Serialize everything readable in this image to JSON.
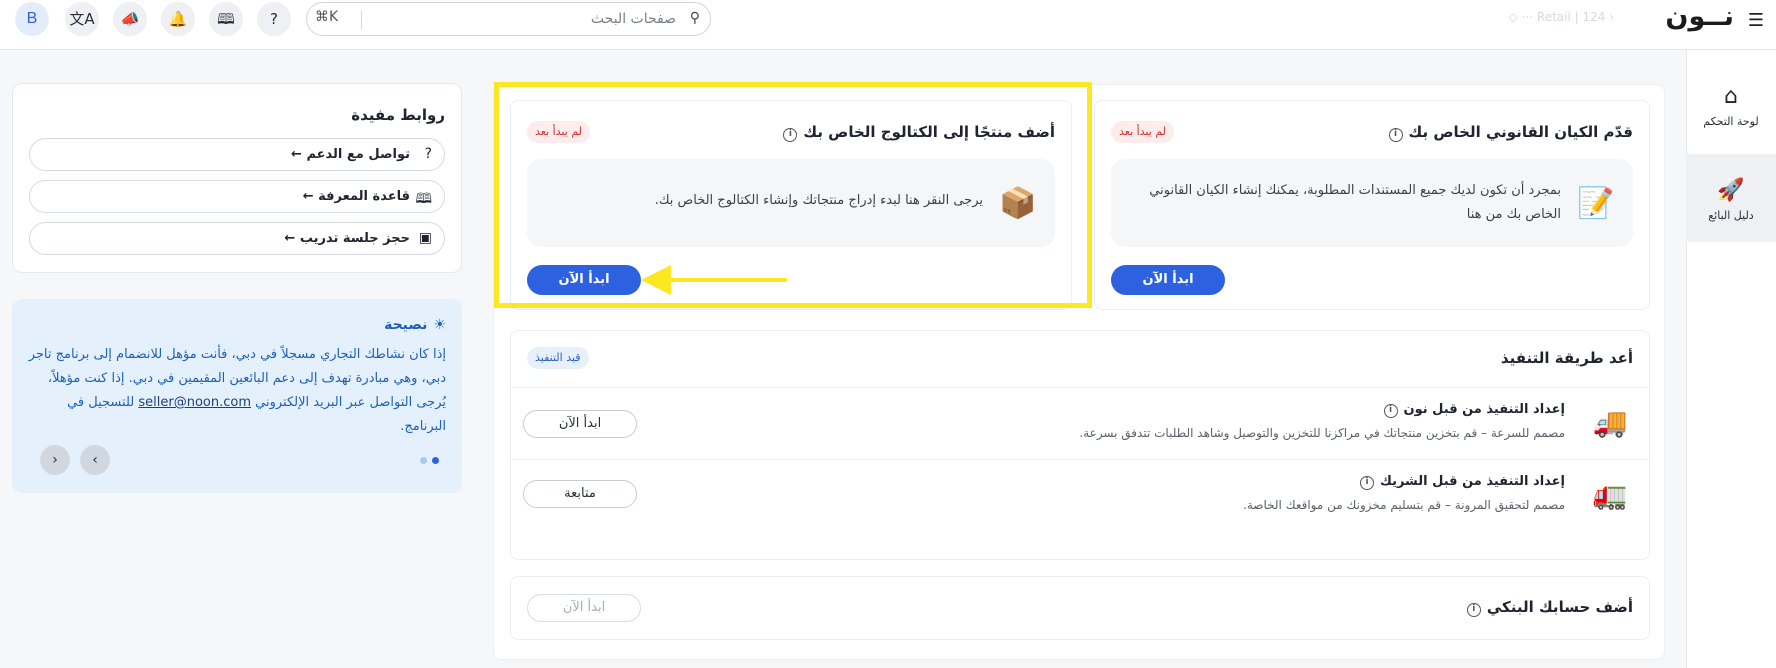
{
  "header": {
    "menu_icon": "hamburger-icon",
    "logo_text": "نــون",
    "store_selector": "Retail | 124",
    "search_placeholder": "صفحات البحث",
    "search_shortcut": "⌘K",
    "avatar_letter": "B",
    "icons": [
      "translate-icon",
      "megaphone-icon",
      "bell-icon",
      "book-icon",
      "help-icon"
    ]
  },
  "sidenav": {
    "items": [
      {
        "label": "لوحة التحكم",
        "icon": "home-icon",
        "active": false
      },
      {
        "label": "دليل البائع",
        "icon": "rocket-icon",
        "active": true
      }
    ]
  },
  "cards": {
    "legal_entity": {
      "title": "قدّم الكيان القانوني الخاص بك",
      "status": "لم يبدأ بعد",
      "description": "بمجرد أن تكون لديك جميع المستندات المطلوبة، يمكنك إنشاء الكيان القانوني الخاص بك من هنا",
      "button": "ابدأ الآن"
    },
    "add_product": {
      "title": "أضف منتجًا إلى الكتالوج الخاص بك",
      "status": "لم يبدأ بعد",
      "description": "يرجى النقر هنا لبدء إدراج منتجاتك وإنشاء الكتالوج الخاص بك.",
      "button": "ابدأ الآن"
    },
    "fulfillment": {
      "title": "أعد طريقة التنفيذ",
      "status": "قيد التنفيذ",
      "options": [
        {
          "title": "إعداد التنفيذ من قبل نون",
          "description": "مصمم للسرعة – قم بتخزين منتجاتك في مراكزنا للتخزين والتوصيل وشاهد الطلبات تتدفق بسرعة.",
          "button": "ابدأ الآن"
        },
        {
          "title": "إعداد التنفيذ من قبل الشريك",
          "description": "مصمم لتحقيق المرونة – قم بتسليم مخزونك من مواقعك الخاصة.",
          "button": "متابعة"
        }
      ]
    },
    "bank": {
      "title": "أضف حسابك البنكي",
      "button": "ابدأ الآن"
    }
  },
  "links": {
    "title": "روابط مفيدة",
    "items": [
      {
        "label": "تواصل مع الدعم",
        "icon": "help-circle-icon"
      },
      {
        "label": "قاعدة المعرفة",
        "icon": "book-icon"
      },
      {
        "label": "حجز جلسة تدريب",
        "icon": "presentation-icon"
      }
    ]
  },
  "tip": {
    "title": "نصيحة",
    "text_before": "إذا كان نشاطك التجاري مسجلاً في دبي، فأنت مؤهل للانضمام إلى برنامج تاجر دبي، وهي مبادرة تهدف إلى دعم البائعين المقيمين في دبي. إذا كنت مؤهلاً، يُرجى التواصل عبر البريد الإلكتروني",
    "email": "seller@noon.com",
    "text_after": "للتسجيل في البرنامج.",
    "dots": 2,
    "active_dot": 0
  },
  "colors": {
    "primary": "#2d61df",
    "highlight": "#fbe722",
    "badge_red_bg": "#fdecec",
    "badge_red_text": "#d32f2f",
    "tip_bg": "#e4f1fc"
  }
}
